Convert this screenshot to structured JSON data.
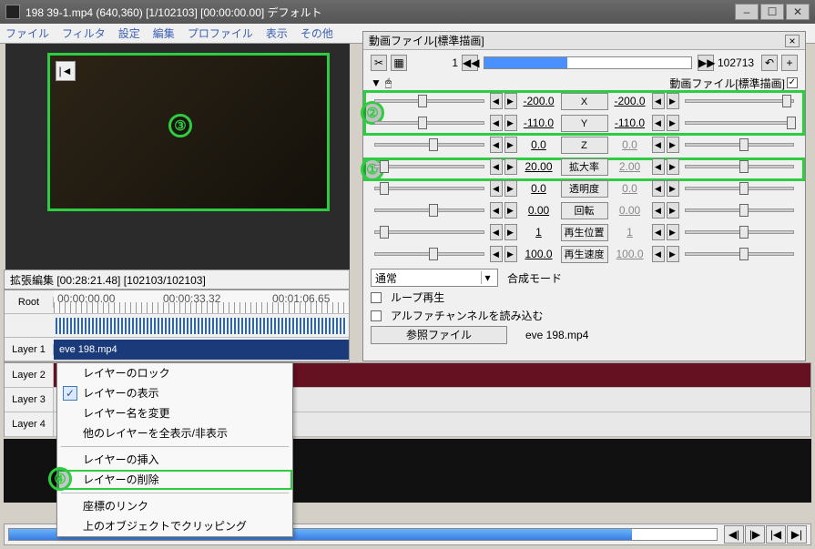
{
  "window": {
    "title": "198 39-1.mp4 (640,360) [1/102103] [00:00:00.00] デフォルト",
    "btn_min": "–",
    "btn_max": "☐",
    "btn_close": "✕"
  },
  "menu": [
    "ファイル",
    "フィルタ",
    "設定",
    "編集",
    "プロファイル",
    "表示",
    "その他"
  ],
  "prop": {
    "title": "動画ファイル[標準描画]",
    "frame_cur": "1",
    "frame_total": "102713",
    "sublabel": "動画ファイル[標準描画]",
    "down": "▼",
    "params": [
      {
        "name": "X",
        "v1": "-200.0",
        "v2": "-200.0",
        "t1": 40,
        "t2": 90
      },
      {
        "name": "Y",
        "v1": "-110.0",
        "v2": "-110.0",
        "t1": 40,
        "t2": 94
      },
      {
        "name": "Z",
        "v1": "0.0",
        "v2": "0.0",
        "t1": 50,
        "t2": 50,
        "dim": true
      },
      {
        "name": "拡大率",
        "v1": "20.00",
        "v2": "2.00",
        "t1": 4,
        "t2": 50,
        "dim": true
      },
      {
        "name": "透明度",
        "v1": "0.0",
        "v2": "0.0",
        "t1": 4,
        "t2": 50,
        "dim": true
      },
      {
        "name": "回転",
        "v1": "0.00",
        "v2": "0.00",
        "t1": 50,
        "t2": 50,
        "dim": true
      },
      {
        "name": "再生位置",
        "v1": "1",
        "v2": "1",
        "t1": 4,
        "t2": 50,
        "dim": true
      },
      {
        "name": "再生速度",
        "v1": "100.0",
        "v2": "100.0",
        "t1": 50,
        "t2": 50,
        "dim": true
      }
    ],
    "blend_label": "合成モード",
    "blend_value": "通常",
    "loop": "ループ再生",
    "alpha": "アルファチャンネルを読み込む",
    "ref_btn": "参照ファイル",
    "ref_file": "eve 198.mp4"
  },
  "timeline": {
    "header": "拡張編集 [00:28:21.48] [102103/102103]",
    "root": "Root",
    "times": [
      "00:00:00.00",
      "00:00:33.32",
      "00:01:06.65"
    ],
    "layers": [
      "Layer 1",
      "Layer 2",
      "Layer 3",
      "Layer 4"
    ],
    "clip": "eve 198.mp4"
  },
  "ctx": {
    "items": [
      "レイヤーのロック",
      "レイヤーの表示",
      "レイヤー名を変更",
      "他のレイヤーを全表示/非表示",
      "レイヤーの挿入",
      "レイヤーの削除",
      "座標のリンク",
      "上のオブジェクトでクリッピング"
    ]
  },
  "annot": {
    "c1": "①",
    "c2": "②",
    "c3": "③",
    "c4": "④"
  },
  "transport": {
    "b1": "◀|",
    "b2": "|▶",
    "b3": "|◀",
    "b4": "▶|"
  }
}
